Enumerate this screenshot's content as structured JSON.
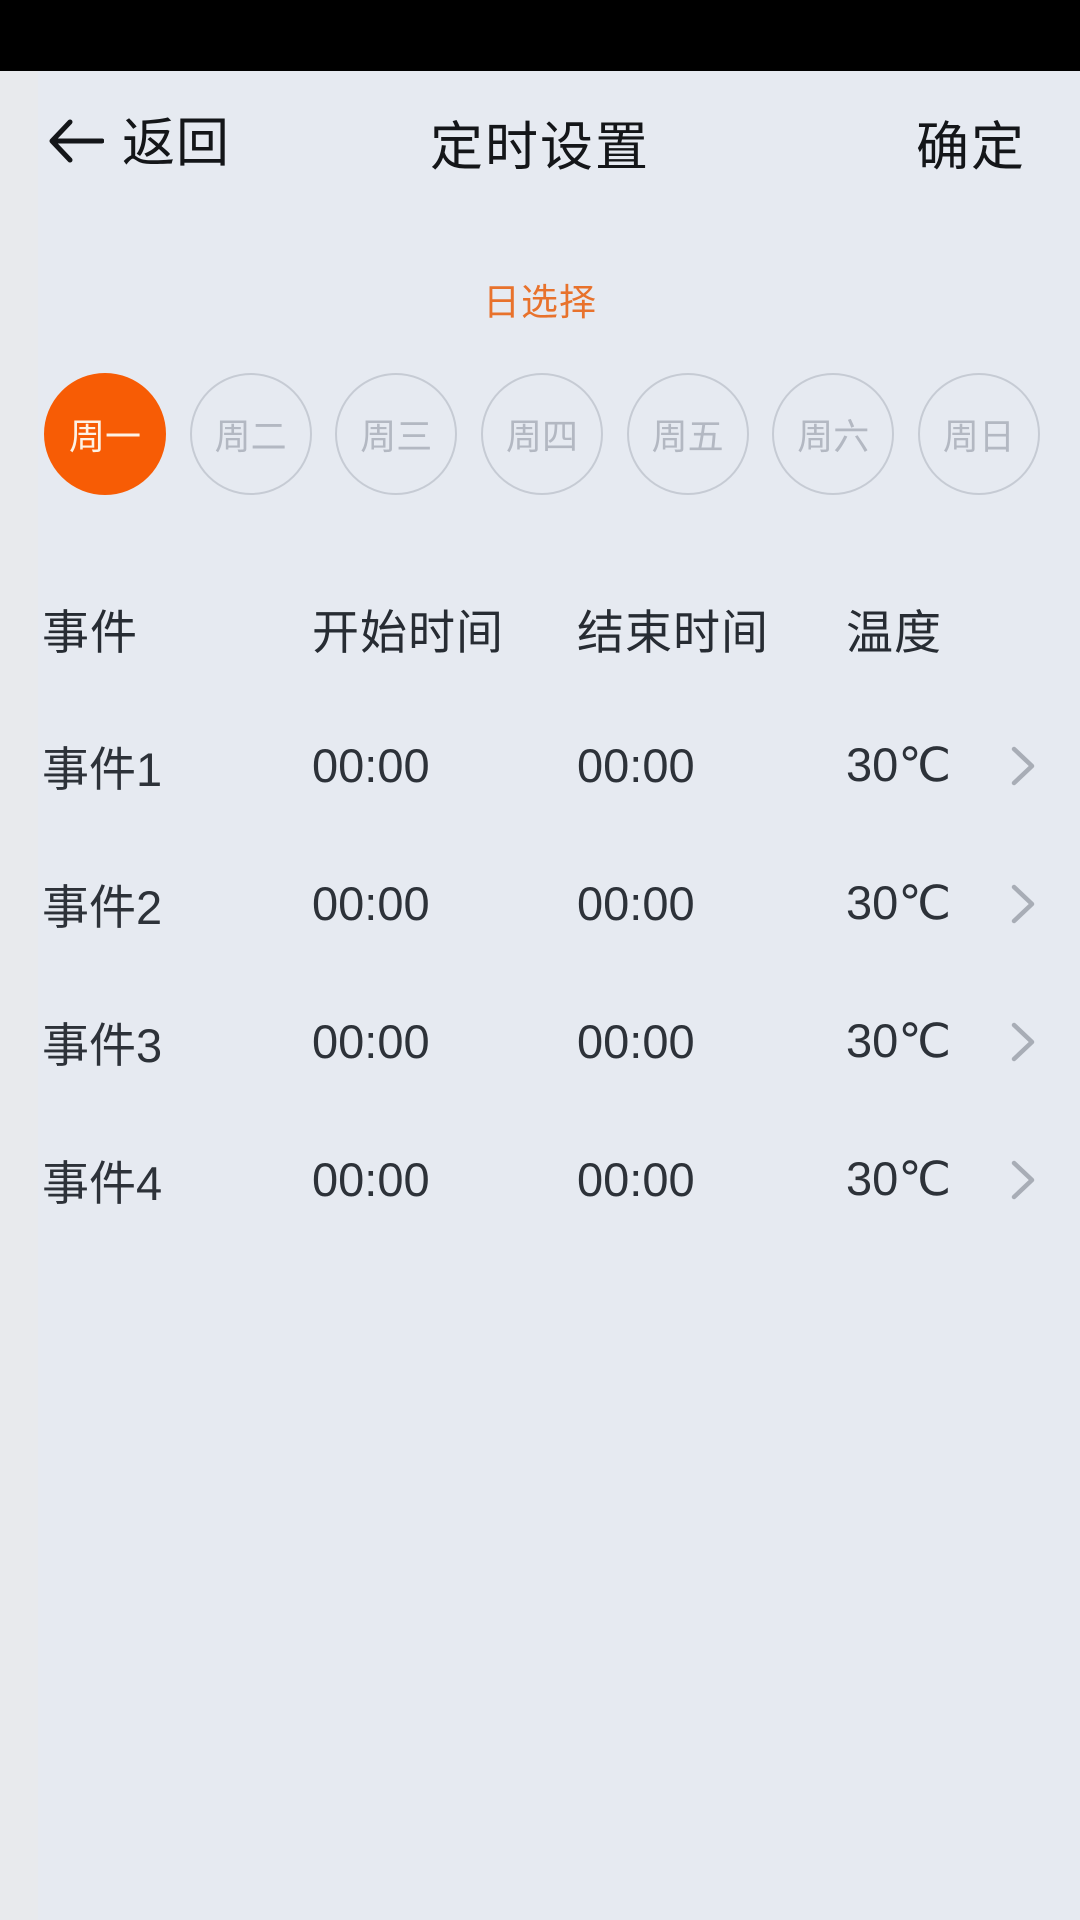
{
  "theme": {
    "background": "#e6eaf1",
    "accent": "#f75c05",
    "accent_text": "#e8722c",
    "text_primary": "#141619",
    "text_body": "#2d3239",
    "chip_off_border": "#c6cbd4",
    "chip_off_text": "#b3b8c2",
    "chevron": "#a8adb6",
    "status_bar": "#000000"
  },
  "header": {
    "back_label": "返回",
    "back_icon": "arrow-left-icon",
    "title": "定时设置",
    "confirm_label": "确定"
  },
  "day_select": {
    "label": "日选择",
    "chips": [
      {
        "label": "周一",
        "selected": true
      },
      {
        "label": "周二",
        "selected": false
      },
      {
        "label": "周三",
        "selected": false
      },
      {
        "label": "周四",
        "selected": false
      },
      {
        "label": "周五",
        "selected": false
      },
      {
        "label": "周六",
        "selected": false
      },
      {
        "label": "周日",
        "selected": false
      }
    ]
  },
  "table": {
    "columns": [
      "事件",
      "开始时间",
      "结束时间",
      "温度"
    ],
    "rows": [
      {
        "event": "事件1",
        "start": "00:00",
        "end": "00:00",
        "temp": "30℃",
        "chevron": "chevron-right-icon"
      },
      {
        "event": "事件2",
        "start": "00:00",
        "end": "00:00",
        "temp": "30℃",
        "chevron": "chevron-right-icon"
      },
      {
        "event": "事件3",
        "start": "00:00",
        "end": "00:00",
        "temp": "30℃",
        "chevron": "chevron-right-icon"
      },
      {
        "event": "事件4",
        "start": "00:00",
        "end": "00:00",
        "temp": "30℃",
        "chevron": "chevron-right-icon"
      }
    ]
  }
}
